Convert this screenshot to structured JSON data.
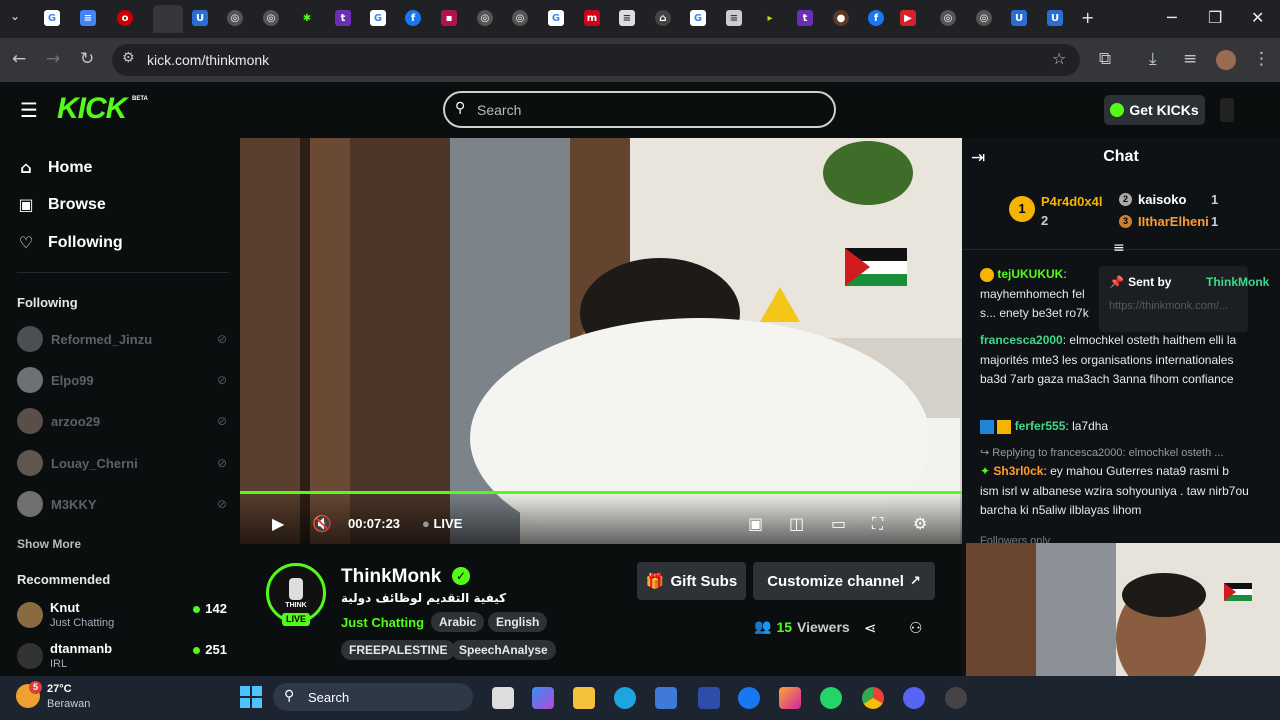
{
  "browser": {
    "url": "kick.com/thinkmonk",
    "colors": {
      "tabstrip": "#202124",
      "toolbar": "#35363a"
    }
  },
  "header": {
    "logo": "KICK",
    "beta": "BETA",
    "search_placeholder": "Search",
    "get_kicks": "Get KICKs"
  },
  "sidebar": {
    "nav": [
      {
        "label": "Home",
        "icon": "home-icon"
      },
      {
        "label": "Browse",
        "icon": "browse-icon"
      },
      {
        "label": "Following",
        "icon": "heart-icon"
      }
    ],
    "following_title": "Following",
    "following": [
      "Reformed_Jinzu",
      "Elpo99",
      "arzoo29",
      "Louay_Cherni",
      "M3KKY"
    ],
    "show_more": "Show More",
    "recommended_title": "Recommended",
    "recommended": [
      {
        "name": "Knut",
        "category": "Just Chatting",
        "viewers": "142"
      },
      {
        "name": "dtanmanb",
        "category": "IRL",
        "viewers": "251"
      }
    ]
  },
  "player": {
    "time": "00:07:23",
    "live_label": "LIVE",
    "progress": 1.0
  },
  "channel": {
    "name": "ThinkMonk",
    "title": "كيفية التقديم لوظائف دولية",
    "category": "Just Chatting",
    "live_badge": "LIVE",
    "avatar_text": "THINK",
    "tags": [
      "Arabic",
      "English",
      "FREEPALESTINE",
      "SpeechAnalyse"
    ],
    "gift_subs": "Gift Subs",
    "customize": "Customize channel",
    "viewers_count": "15",
    "viewers_label": "Viewers"
  },
  "chat": {
    "title": "Chat",
    "gifters": [
      {
        "name": "P4r4d0x4l",
        "count": "2",
        "rank": "1"
      },
      {
        "name": "kaisoko",
        "count": "1",
        "rank": "2"
      },
      {
        "name": "IItharElheni",
        "count": "1",
        "rank": "3"
      }
    ],
    "pinned": {
      "label": "Sent by",
      "user": "ThinkMonk",
      "link": "https://thinkmonk.com/..."
    },
    "messages": [
      {
        "user": "tejUKUKUK",
        "text": "mayhemhomech fel s... enety be3et ro7k"
      },
      {
        "user": "francesca2000",
        "text": "elmochkel osteth haithem elli la majorités mte3 les organisations internationales ba3d 7arb gaza ma3ach 3anna fihom confiance"
      },
      {
        "user": "ferfer555",
        "text": "la7dha"
      },
      {
        "user": "Sh3rl0ck",
        "reply": "Replying to francesca2000: elmochkel osteth ...",
        "text": "ey mahou Guterres nata9 rasmi b ism isrl w albanese wzira sohyouniya . taw nirb7ou barcha ki n5aliw ilblayas lihom"
      }
    ],
    "followers_only": "Followers only"
  },
  "taskbar": {
    "temp": "27°C",
    "weather": "Berawan",
    "search": "Search",
    "badge": "5"
  }
}
